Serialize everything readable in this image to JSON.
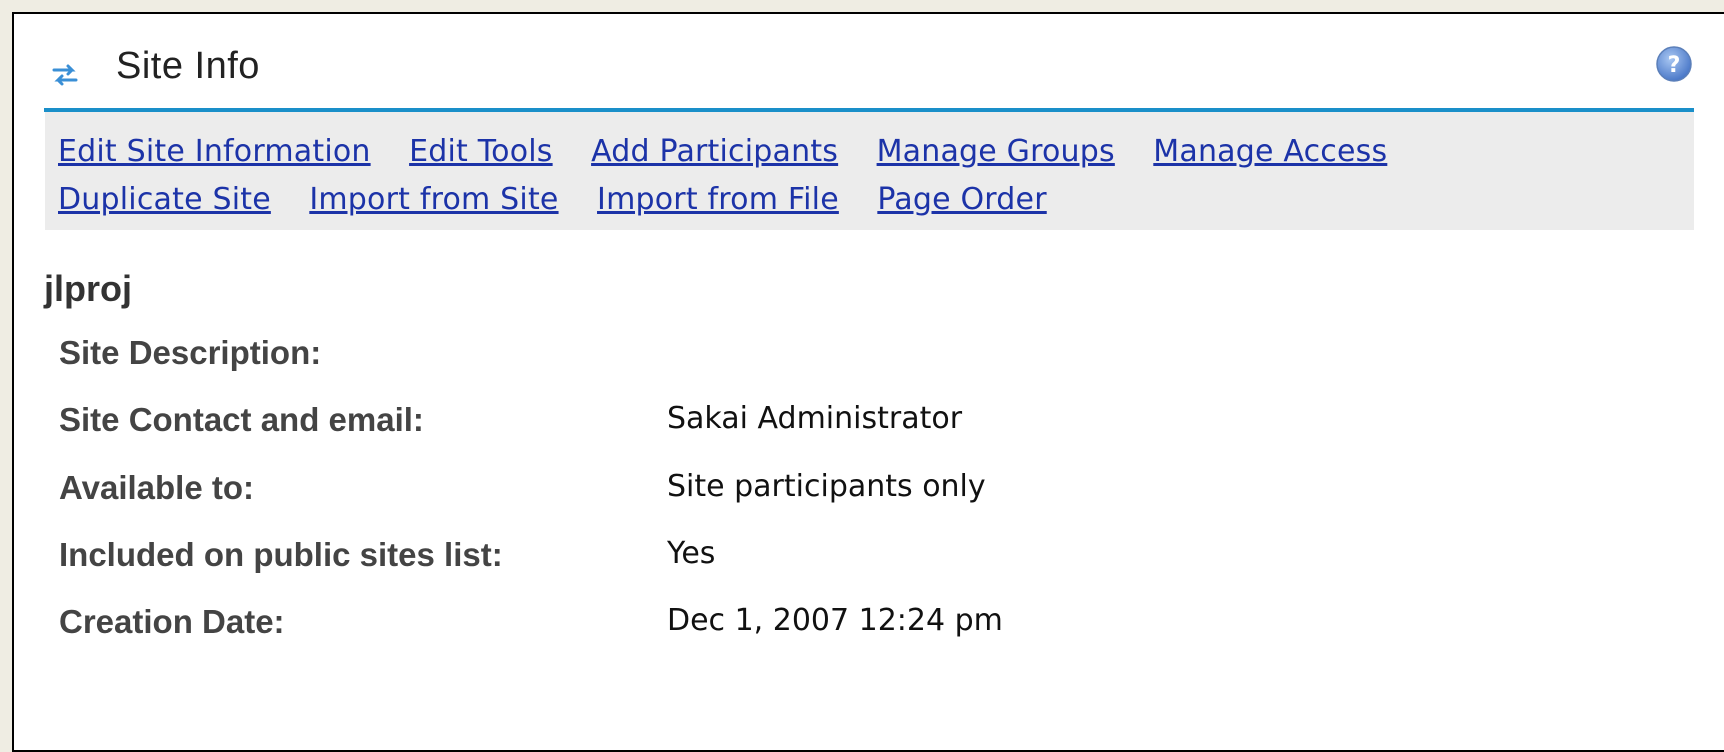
{
  "tool": {
    "title": "Site Info",
    "icon": "refresh-arrows-icon",
    "help_icon": "help-icon"
  },
  "toolbar": {
    "row1": [
      "Edit Site Information",
      "Edit Tools",
      "Add Participants",
      "Manage Groups",
      "Manage Access"
    ],
    "row2": [
      "Duplicate Site",
      "Import from Site",
      "Import from File",
      "Page Order"
    ]
  },
  "site": {
    "title": "jlproj",
    "details": [
      {
        "label": "Site Description:",
        "value": ""
      },
      {
        "label": "Site Contact and email:",
        "value": "Sakai Administrator"
      },
      {
        "label": "Available to:",
        "value": "Site participants only"
      },
      {
        "label": "Included on public sites list:",
        "value": "Yes"
      },
      {
        "label": "Creation Date:",
        "value": "Dec 1, 2007 12:24 pm"
      }
    ]
  },
  "colors": {
    "link": "#1c33a8",
    "accent_rule": "#1a8fc9",
    "toolbar_bg": "#ececec",
    "page_bg": "#efede3"
  }
}
